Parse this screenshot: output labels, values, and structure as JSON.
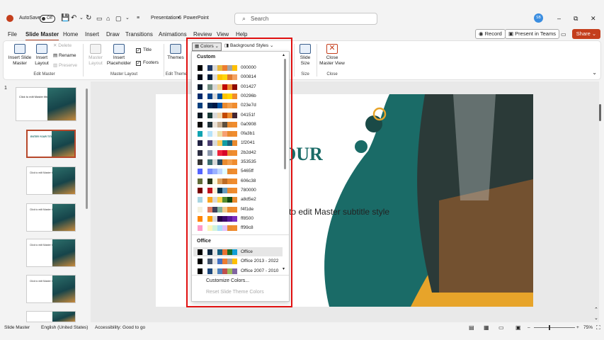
{
  "titlebar": {
    "autosave_label": "AutoSave",
    "autosave_state": "Off",
    "file_name": "Presentation6",
    "separator": "•",
    "app_name": "PowerPoint",
    "search_placeholder": "Search",
    "user_initials": "SB",
    "minimize": "–",
    "restore": "⧉",
    "close": "✕"
  },
  "tabs": [
    {
      "label": "File"
    },
    {
      "label": "Slide Master",
      "active": true
    },
    {
      "label": "Home"
    },
    {
      "label": "Insert"
    },
    {
      "label": "Draw"
    },
    {
      "label": "Transitions"
    },
    {
      "label": "Animations"
    },
    {
      "label": "Review"
    },
    {
      "label": "View"
    },
    {
      "label": "Help"
    }
  ],
  "header_actions": {
    "record": "Record",
    "present": "Present in Teams",
    "share": "Share"
  },
  "ribbon": {
    "insert_slide_master": "Insert Slide Master",
    "insert_layout": "Insert Layout",
    "delete": "Delete",
    "rename": "Rename",
    "preserve": "Preserve",
    "edit_master_group": "Edit Master",
    "master_layout": "Master Layout",
    "insert_placeholder": "Insert Placeholder",
    "title_check": "Title",
    "footers_check": "Footers",
    "master_layout_group": "Master Layout",
    "themes": "Themes",
    "edit_theme_group": "Edit Theme",
    "colors_button": "Colors",
    "background_styles": "Background Styles",
    "slide_size": "Slide Size",
    "size_group": "Size",
    "close_master_view": "Close Master View",
    "close_group": "Close"
  },
  "thumbnails": {
    "slide_number": "1",
    "master_title": "Click to edit Master title style",
    "layout2_title": "ENTER YOUR TITLE",
    "layout_text": "Click to edit Master title style"
  },
  "slide": {
    "title_fragment": "OUR",
    "subtitle_fragment": "to edit Master subtitle style"
  },
  "dropdown": {
    "custom_header": "Custom",
    "office_header": "Office",
    "custom_themes": [
      {
        "name": "000000",
        "colors": [
          "#000000",
          "#ffffff",
          "#1f3864",
          "#d9d9d9",
          "#e7b73c",
          "#ed7d31",
          "#a5a5a5",
          "#ffc000"
        ]
      },
      {
        "name": "000814",
        "colors": [
          "#000814",
          "#ffffff",
          "#001d3d",
          "#d9d9d9",
          "#ffc300",
          "#ffd60a",
          "#e07a2e",
          "#f4a261"
        ]
      },
      {
        "name": "001427",
        "colors": [
          "#001427",
          "#ffffff",
          "#708d81",
          "#d9d9d9",
          "#f4d58d",
          "#bf0603",
          "#e98a2f",
          "#8d0801"
        ]
      },
      {
        "name": "00296b",
        "colors": [
          "#00296b",
          "#ffffff",
          "#003f88",
          "#d9d9d9",
          "#00509d",
          "#fdc500",
          "#ffd500",
          "#f08c2e"
        ]
      },
      {
        "name": "023e7d",
        "colors": [
          "#023e7d",
          "#ffffff",
          "#002855",
          "#001845",
          "#0353a4",
          "#e98a2f",
          "#f29e4c",
          "#f08c2e"
        ]
      },
      {
        "name": "04151f",
        "colors": [
          "#04151f",
          "#ffffff",
          "#183a37",
          "#d9d9d9",
          "#efd6ac",
          "#c44900",
          "#e98a2f",
          "#432534"
        ]
      },
      {
        "name": "0a0908",
        "colors": [
          "#0a0908",
          "#ffffff",
          "#22333b",
          "#eae0d5",
          "#c6ac8f",
          "#5e503f",
          "#e98a2f",
          "#f08c2e"
        ]
      },
      {
        "name": "0fa3b1",
        "colors": [
          "#0fa3b1",
          "#ffffff",
          "#b5e2fa",
          "#f9f7f3",
          "#eddea4",
          "#f7a072",
          "#e98a2f",
          "#f08c2e"
        ]
      },
      {
        "name": "1f2041",
        "colors": [
          "#1f2041",
          "#ffffff",
          "#4b3f72",
          "#d9d9d9",
          "#ffc857",
          "#119da4",
          "#19647e",
          "#e98a2f"
        ]
      },
      {
        "name": "2b2d42",
        "colors": [
          "#2b2d42",
          "#ffffff",
          "#8d99ae",
          "#edf2f4",
          "#ef233c",
          "#d90429",
          "#e98a2f",
          "#f08c2e"
        ]
      },
      {
        "name": "353535",
        "colors": [
          "#353535",
          "#ffffff",
          "#3c6e71",
          "#d9d9d9",
          "#284b63",
          "#e98a2f",
          "#f29e4c",
          "#f08c2e"
        ]
      },
      {
        "name": "5465ff",
        "colors": [
          "#5465ff",
          "#ffffff",
          "#788bff",
          "#9bb1ff",
          "#bfd7ff",
          "#e2fdff",
          "#e98a2f",
          "#f08c2e"
        ]
      },
      {
        "name": "606c38",
        "colors": [
          "#606c38",
          "#ffffff",
          "#283618",
          "#fefae0",
          "#dda15e",
          "#bc6c25",
          "#e98a2f",
          "#f08c2e"
        ]
      },
      {
        "name": "780000",
        "colors": [
          "#780000",
          "#ffffff",
          "#c1121f",
          "#fdf0d5",
          "#003049",
          "#669bbc",
          "#e98a2f",
          "#f08c2e"
        ]
      },
      {
        "name": "a8d5e2",
        "colors": [
          "#a8d5e2",
          "#ffffff",
          "#f9a620",
          "#d9d9d9",
          "#ffd449",
          "#548c2f",
          "#104911",
          "#e98a2f"
        ]
      },
      {
        "name": "f4f1de",
        "colors": [
          "#f4f1de",
          "#ffffff",
          "#e07a5f",
          "#3d405b",
          "#81b29a",
          "#f2cc8f",
          "#e98a2f",
          "#f08c2e"
        ]
      },
      {
        "name": "ff8500",
        "colors": [
          "#ff8500",
          "#ffffff",
          "#ff9e00",
          "#d9d9d9",
          "#240046",
          "#3c096c",
          "#5a189a",
          "#7b2cbf"
        ]
      },
      {
        "name": "ff99c8",
        "colors": [
          "#ff99c8",
          "#ffffff",
          "#fcf6bd",
          "#d0f4de",
          "#a9def9",
          "#e4c1f9",
          "#e98a2f",
          "#f08c2e"
        ]
      }
    ],
    "office_themes": [
      {
        "name": "Office",
        "colors": [
          "#000000",
          "#ffffff",
          "#0e2841",
          "#e8e8e8",
          "#156082",
          "#e97132",
          "#196b24",
          "#0f9ed5"
        ],
        "highlight": true
      },
      {
        "name": "Office 2013 - 2022",
        "colors": [
          "#000000",
          "#ffffff",
          "#44546a",
          "#e7e6e6",
          "#4472c4",
          "#ed7d31",
          "#a5a5a5",
          "#ffc000"
        ]
      },
      {
        "name": "Office 2007 - 2010",
        "colors": [
          "#000000",
          "#ffffff",
          "#1f497d",
          "#eeece1",
          "#4f81bd",
          "#c0504d",
          "#9bbb59",
          "#8064a2"
        ]
      }
    ],
    "customize_colors": "Customize Colors...",
    "reset_colors": "Reset Slide Theme Colors"
  },
  "status": {
    "view": "Slide Master",
    "language": "English (United States)",
    "accessibility": "Accessibility: Good to go",
    "zoom_minus": "–",
    "zoom_plus": "+",
    "zoom": "75%"
  },
  "colors": {
    "accent": "#b7472a",
    "share_button": "#c43e1c",
    "highlight_box": "#e01010",
    "teal": "#1a6b67",
    "gold": "#e7a42a"
  }
}
